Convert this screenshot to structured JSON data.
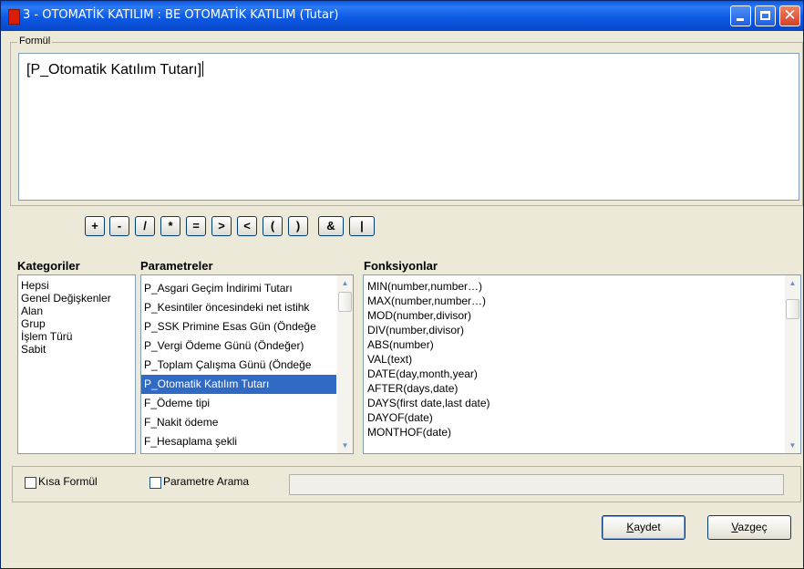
{
  "window": {
    "title": "3 - OTOMATİK KATILIM : BE OTOMATİK KATILIM (Tutar)",
    "icon": "app-icon",
    "controls": [
      "minimize-icon",
      "maximize-icon",
      "close-icon"
    ]
  },
  "formula": {
    "legend": "Formül",
    "text": "[P_Otomatik Katılım Tutarı]"
  },
  "operators": [
    "+",
    "-",
    "/",
    "*",
    "=",
    ">",
    "<",
    "(",
    ")",
    "&",
    "|"
  ],
  "categories": {
    "label": "Kategoriler",
    "items": [
      "Hepsi",
      "Genel Değişkenler",
      "Alan",
      "Grup",
      "İşlem Türü",
      "Sabit"
    ]
  },
  "parameters": {
    "label": "Parametreler",
    "items": [
      "P_Asgari Geçim İndirimi Tutarı",
      "P_Kesintiler öncesindeki net istihk",
      "P_SSK Primine Esas Gün  (Öndeğe",
      "P_Vergi Ödeme Günü  (Öndeğer)",
      "P_Toplam Çalışma Günü  (Öndeğe",
      "P_Otomatik Katılım Tutarı",
      "F_Ödeme tipi",
      "F_Nakit ödeme",
      "F_Hesaplama şekli"
    ],
    "selected_index": 5
  },
  "functions": {
    "label": "Fonksiyonlar",
    "items": [
      "MIN(number,number…)",
      "MAX(number,number…)",
      "MOD(number,divisor)",
      "DIV(number,divisor)",
      "ABS(number)",
      "VAL(text)",
      "DATE(day,month,year)",
      "AFTER(days,date)",
      "DAYS(first date,last date)",
      "DAYOF(date)",
      "MONTHOF(date)"
    ]
  },
  "options": {
    "short_formula": {
      "label": "Kısa Formül",
      "checked": false
    },
    "param_search": {
      "label": "Parametre Arama",
      "checked": false
    },
    "search_value": ""
  },
  "buttons": {
    "save": {
      "accel": "K",
      "rest": "aydet"
    },
    "cancel": {
      "accel": "V",
      "rest": "azgeç"
    }
  },
  "colors": {
    "title_bar": "#0a58e0",
    "selection": "#316ac5",
    "window_face": "#ece9d8",
    "close_button": "#d6402b"
  }
}
